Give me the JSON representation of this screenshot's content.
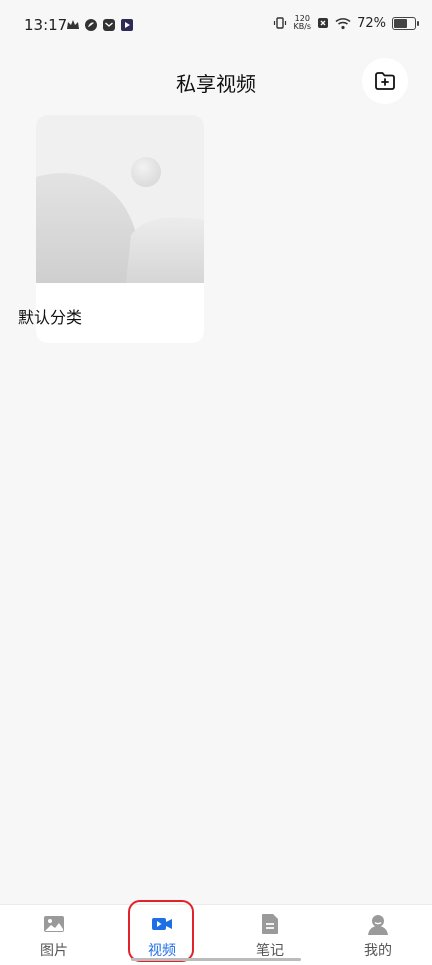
{
  "status_bar": {
    "time": "13:17",
    "net_speed_value": "120",
    "net_speed_unit": "KB/s",
    "battery_percent": "72%",
    "battery_level": 0.72
  },
  "header": {
    "title": "私享视频",
    "add_icon": "folder-plus-icon"
  },
  "categories": [
    {
      "label": "默认分类",
      "thumbnail_icon": "image-placeholder-icon"
    }
  ],
  "bottom_nav": {
    "active_index": 1,
    "items": [
      {
        "label": "图片",
        "icon": "image-icon"
      },
      {
        "label": "视频",
        "icon": "video-camera-icon"
      },
      {
        "label": "笔记",
        "icon": "document-icon"
      },
      {
        "label": "我的",
        "icon": "person-icon"
      }
    ]
  },
  "colors": {
    "accent": "#1e6fe6",
    "highlight_box": "#e0222a",
    "background": "#f7f7f7"
  }
}
